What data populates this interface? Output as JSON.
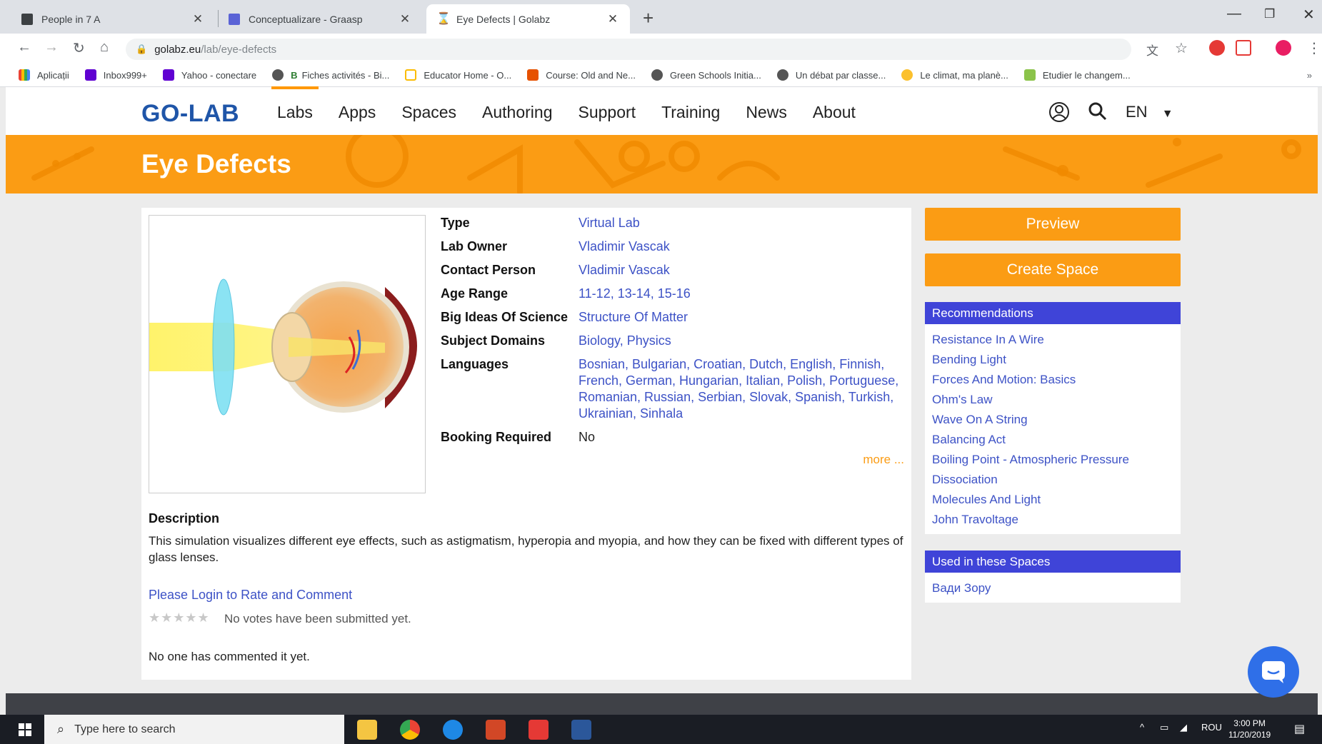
{
  "browser": {
    "tabs": [
      {
        "title": "People in 7 A",
        "active": false
      },
      {
        "title": "Conceptualizare - Graasp",
        "active": false
      },
      {
        "title": "Eye Defects | Golabz",
        "active": true
      }
    ],
    "url_host": "golabz.eu",
    "url_path": "/lab/eye-defects",
    "bookmarks": [
      "Aplicații",
      "Inbox999+",
      "Yahoo - conectare",
      "Fiches activités - Bi...",
      "Educator Home - O...",
      "Course: Old and Ne...",
      "Green Schools Initia...",
      "Un débat par classe...",
      "Le climat, ma planè...",
      "Etudier le changem..."
    ]
  },
  "site": {
    "logo": "GO-LAB",
    "nav": [
      "Labs",
      "Apps",
      "Spaces",
      "Authoring",
      "Support",
      "Training",
      "News",
      "About"
    ],
    "active_nav": "Labs",
    "language": "EN"
  },
  "page": {
    "title": "Eye Defects",
    "properties": [
      {
        "key": "Type",
        "value": "Virtual Lab",
        "link": true
      },
      {
        "key": "Lab Owner",
        "value": "Vladimir Vascak",
        "link": true
      },
      {
        "key": "Contact Person",
        "value": "Vladimir Vascak",
        "link": true
      },
      {
        "key": "Age Range",
        "value": "11-12, 13-14, 15-16",
        "link": true
      },
      {
        "key": "Big Ideas Of Science",
        "value": "Structure Of Matter",
        "link": true
      },
      {
        "key": "Subject Domains",
        "value": "Biology, Physics",
        "link": true
      },
      {
        "key": "Languages",
        "value": "Bosnian, Bulgarian, Croatian, Dutch, English, Finnish, French, German, Hungarian, Italian, Polish, Portuguese, Romanian, Russian, Serbian, Slovak, Spanish, Turkish, Ukrainian, Sinhala",
        "link": true
      },
      {
        "key": "Booking Required",
        "value": "No",
        "link": false
      }
    ],
    "more_label": "more ...",
    "description_title": "Description",
    "description": "This simulation visualizes different eye effects, such as astigmatism, hyperopia and myopia, and how they can be fixed with different types of glass lenses.",
    "login_link": "Please Login to Rate and Comment",
    "votes_text": "No votes have been submitted yet.",
    "rating": 0,
    "comments_text": "No one has commented it yet."
  },
  "sidebar": {
    "preview_label": "Preview",
    "create_space_label": "Create Space",
    "recommendations_title": "Recommendations",
    "recommendations": [
      "Resistance In A Wire",
      "Bending Light",
      "Forces And Motion: Basics",
      "Ohm's Law",
      "Wave On A String",
      "Balancing Act",
      "Boiling Point - Atmospheric Pressure",
      "Dissociation",
      "Molecules And Light",
      "John Travoltage"
    ],
    "spaces_title": "Used in these Spaces",
    "spaces": [
      "Вади Зору"
    ]
  },
  "taskbar": {
    "search_placeholder": "Type here to search",
    "language": "ROU",
    "time": "3:00 PM",
    "date": "11/20/2019"
  },
  "colors": {
    "orange": "#fb9c14",
    "link_blue": "#3d52c6",
    "header_purple": "#3f44d8",
    "logo_blue": "#1f55a8"
  }
}
